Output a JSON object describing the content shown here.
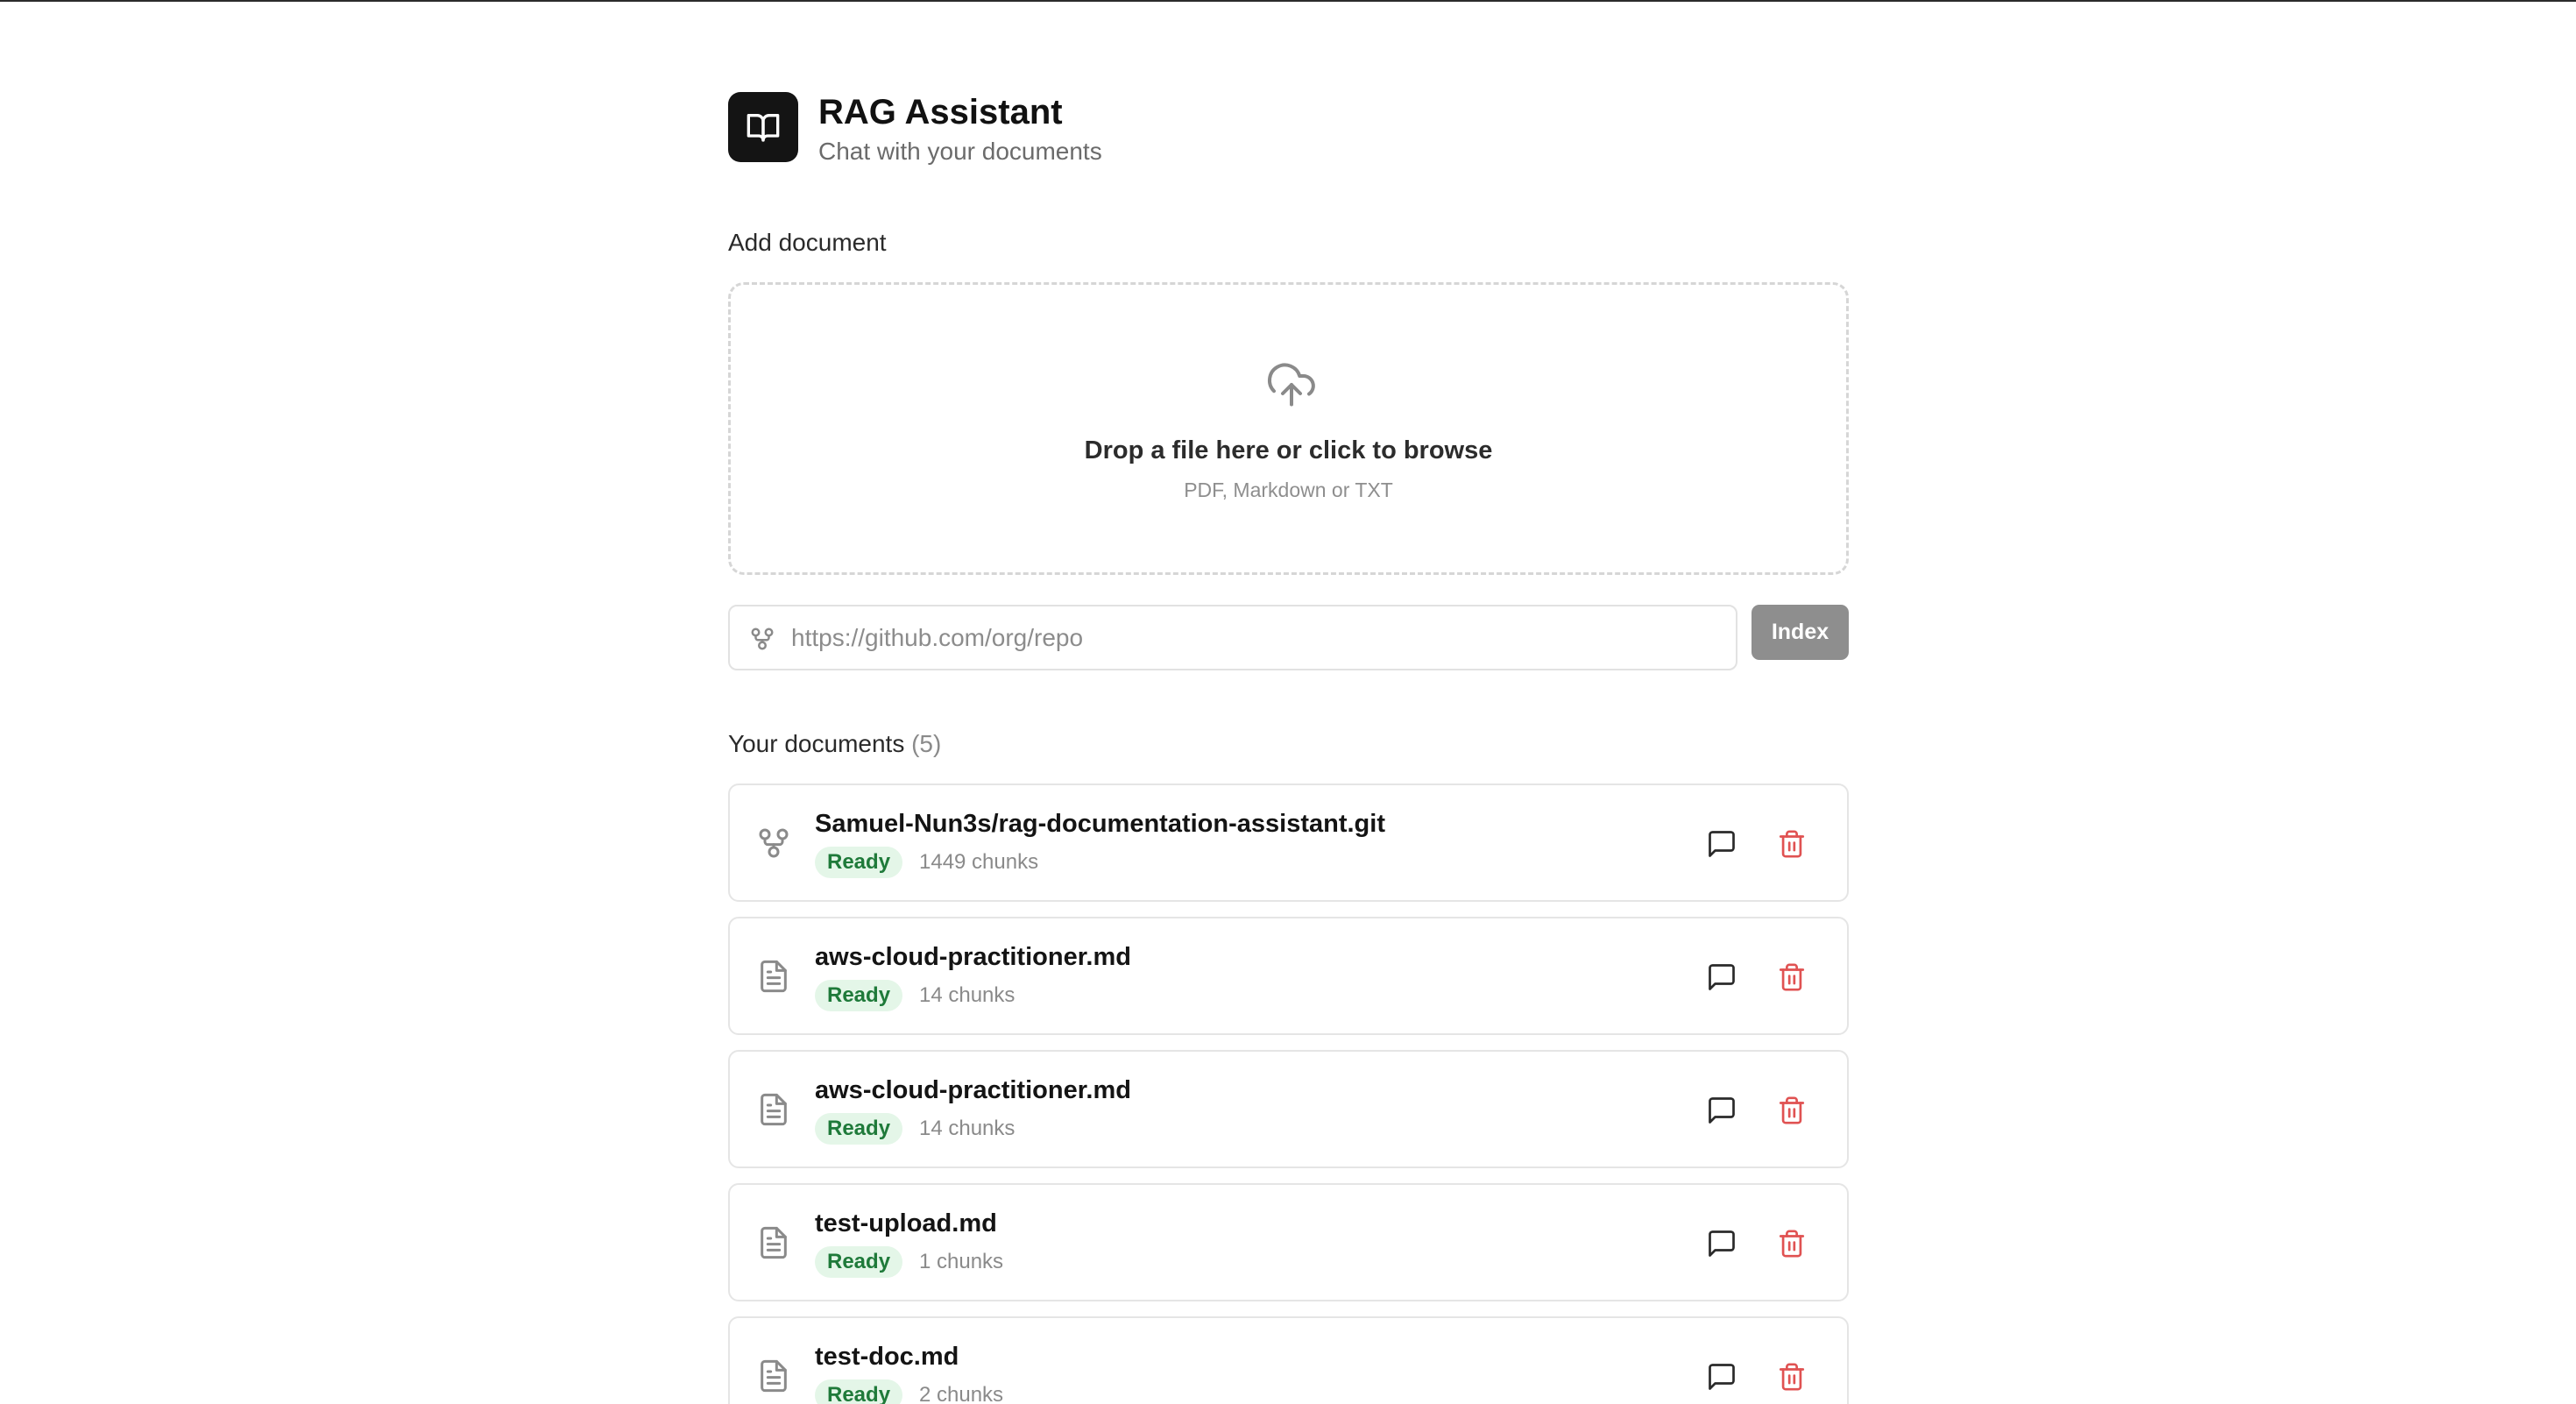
{
  "app": {
    "title": "RAG Assistant",
    "subtitle": "Chat with your documents"
  },
  "upload": {
    "section_label": "Add document",
    "drop_title": "Drop a file here or click to browse",
    "drop_hint": "PDF, Markdown or TXT",
    "repo_placeholder": "https://github.com/org/repo",
    "index_label": "Index"
  },
  "documents": {
    "section_label": "Your documents",
    "count_label": "(5)",
    "items": [
      {
        "name": "Samuel-Nun3s/rag-documentation-assistant.git",
        "status": "Ready",
        "chunks": "1449 chunks",
        "icon": "git-branch-icon"
      },
      {
        "name": "aws-cloud-practitioner.md",
        "status": "Ready",
        "chunks": "14 chunks",
        "icon": "file-text-icon"
      },
      {
        "name": "aws-cloud-practitioner.md",
        "status": "Ready",
        "chunks": "14 chunks",
        "icon": "file-text-icon"
      },
      {
        "name": "test-upload.md",
        "status": "Ready",
        "chunks": "1 chunks",
        "icon": "file-text-icon"
      },
      {
        "name": "test-doc.md",
        "status": "Ready",
        "chunks": "2 chunks",
        "icon": "file-text-icon"
      }
    ]
  },
  "colors": {
    "accent_dark": "#141414",
    "status_green_bg": "#e4f6e8",
    "status_green_text": "#1f7a3a",
    "delete_red": "#e05252",
    "index_button_bg": "#8e8e8e"
  }
}
